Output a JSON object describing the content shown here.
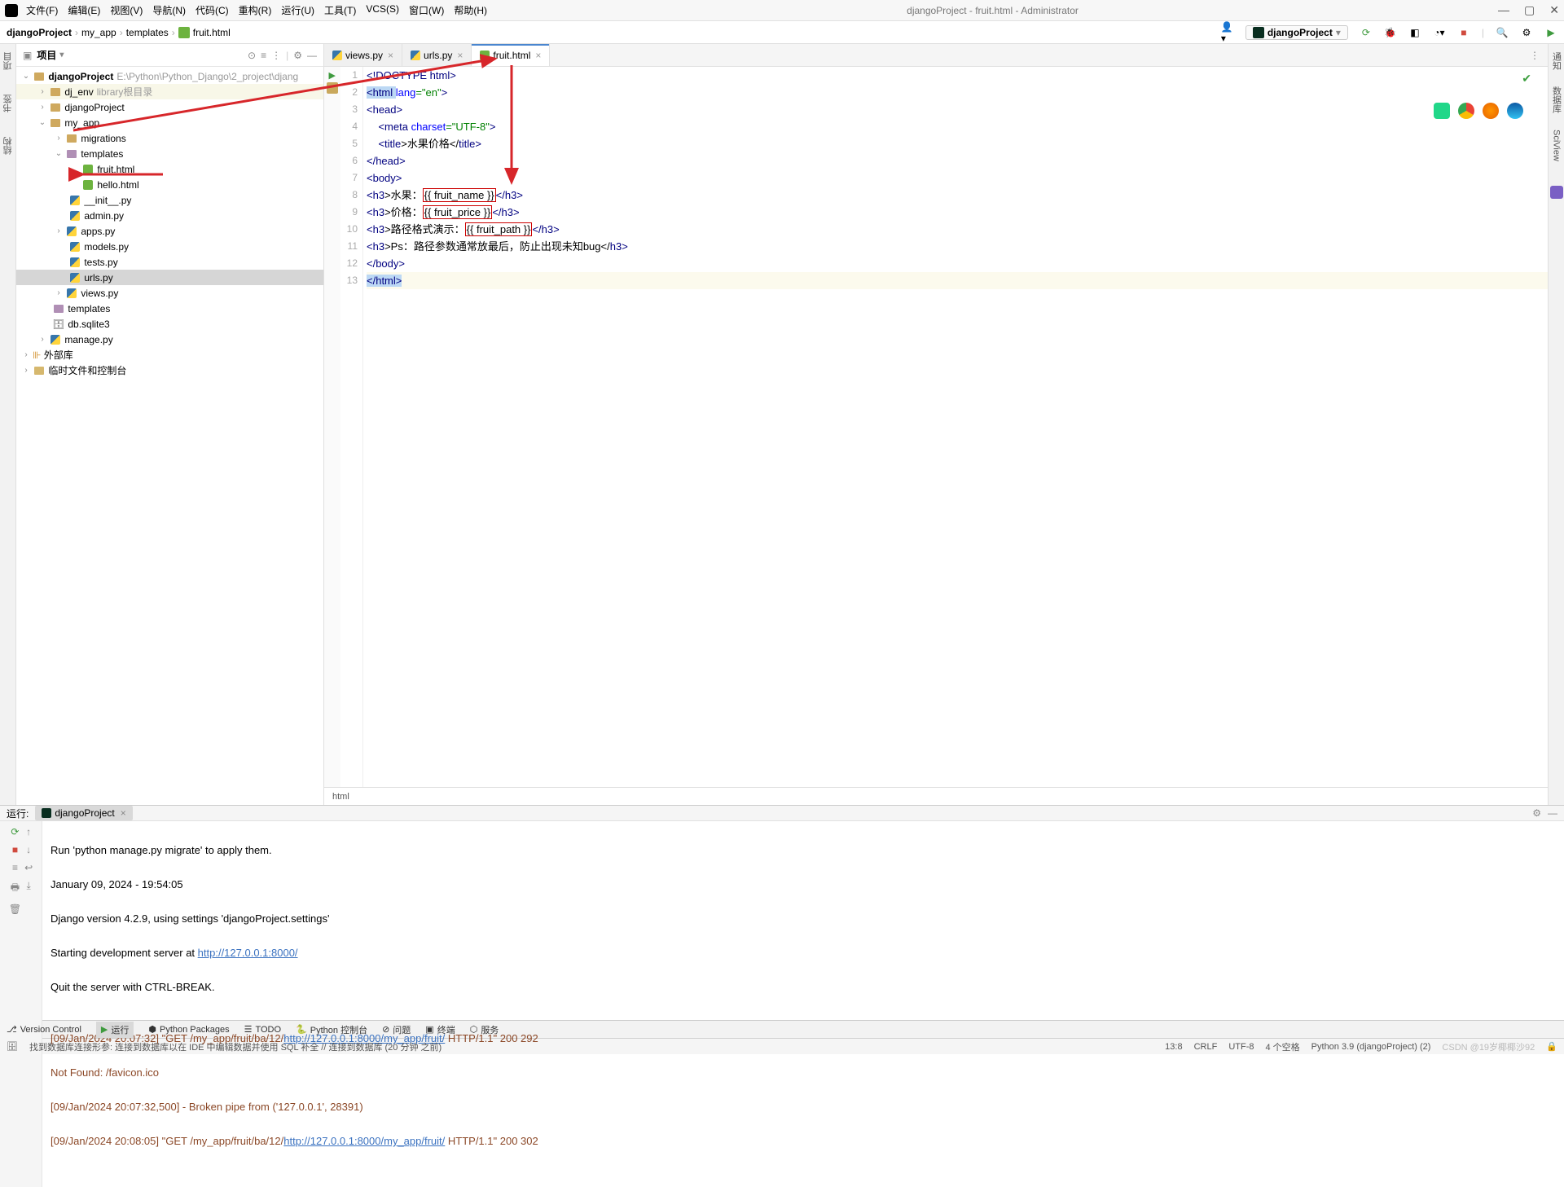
{
  "window": {
    "title": "djangoProject - fruit.html - Administrator"
  },
  "menu": {
    "file": "文件(F)",
    "edit": "编辑(E)",
    "view": "视图(V)",
    "navigate": "导航(N)",
    "code": "代码(C)",
    "refactor": "重构(R)",
    "run": "运行(U)",
    "tools": "工具(T)",
    "vcs": "VCS(S)",
    "window": "窗口(W)",
    "help": "帮助(H)"
  },
  "breadcrumbs": [
    "djangoProject",
    "my_app",
    "templates",
    "fruit.html"
  ],
  "run_config_name": "djangoProject",
  "project_panel": {
    "title": "项目"
  },
  "tree": {
    "root": "djangoProject",
    "root_path": "E:\\Python\\Python_Django\\2_project\\djang",
    "dj_env": "dj_env",
    "dj_env_hint": "library根目录",
    "django_project": "djangoProject",
    "my_app": "my_app",
    "migrations": "migrations",
    "templates": "templates",
    "fruit_html": "fruit.html",
    "hello_html": "hello.html",
    "init_py": "__init__.py",
    "admin_py": "admin.py",
    "apps_py": "apps.py",
    "models_py": "models.py",
    "tests_py": "tests.py",
    "urls_py": "urls.py",
    "views_py": "views.py",
    "templates2": "templates",
    "db_sqlite3": "db.sqlite3",
    "manage_py": "manage.py",
    "external_libs": "外部库",
    "scratches": "临时文件和控制台"
  },
  "tabs": {
    "views": "views.py",
    "urls": "urls.py",
    "fruit": "fruit.html"
  },
  "gutter": [
    "1",
    "2",
    "3",
    "4",
    "5",
    "6",
    "7",
    "8",
    "9",
    "10",
    "11",
    "12",
    "13"
  ],
  "code": {
    "l1_a": "<!DOCTYPE ",
    "l1_b": "html",
    "l1_c": ">",
    "l2_a": "<",
    "l2_b": "html ",
    "l2_c": "lang",
    "l2_d": "=\"en\"",
    "l2_e": ">",
    "l3": "<head>",
    "l4_a": "    <",
    "l4_b": "meta ",
    "l4_c": "charset",
    "l4_d": "=\"UTF-8\"",
    "l4_e": ">",
    "l5_a": "    <",
    "l5_b": "title",
    "l5_c": ">水果价格</",
    "l5_d": "title",
    "l5_e": ">",
    "l6": "</head>",
    "l7": "<body>",
    "l8_a": "<",
    "l8_b": "h3",
    "l8_c": ">水果：",
    "l8_brace": "{{ fruit_name }}",
    "l8_d": "</",
    "l8_e": "h3",
    "l8_f": ">",
    "l9_a": "<",
    "l9_b": "h3",
    "l9_c": ">价格：",
    "l9_brace": "{{ fruit_price }}",
    "l9_d": "</",
    "l9_e": "h3",
    "l9_f": ">",
    "l10_a": "<",
    "l10_b": "h3",
    "l10_c": ">路径格式演示：",
    "l10_brace": "{{ fruit_path }}",
    "l10_d": "</",
    "l10_e": "h3",
    "l10_f": ">",
    "l11_a": "<",
    "l11_b": "h3",
    "l11_c": ">Ps：路径参数通常放最后，防止出现未知bug</",
    "l11_d": "h3",
    "l11_e": ">",
    "l12": "</body>",
    "l13_a": "</",
    "l13_b": "html",
    "l13_c": ">"
  },
  "editor_breadcrumb": "html",
  "run": {
    "label": "运行:",
    "tab": "djangoProject"
  },
  "console": {
    "l1": "Run 'python manage.py migrate' to apply them.",
    "l2": "January 09, 2024 - 19:54:05",
    "l3": "Django version 4.2.9, using settings 'djangoProject.settings'",
    "l4a": "Starting development server at ",
    "l4b": "http://127.0.0.1:8000/",
    "l5": "Quit the server with CTRL-BREAK.",
    "l6": "",
    "l7a": "[09/Jan/2024 20:07:32] \"GET /my_app/fruit/ba/12/",
    "l7b": "http://127.0.0.1:8000/my_app/fruit/",
    "l7c": " HTTP/1.1\" 200 292",
    "l8": "Not Found: /favicon.ico",
    "l9": "[09/Jan/2024 20:07:32,500] - Broken pipe from ('127.0.0.1', 28391)",
    "l10a": "[09/Jan/2024 20:08:05] \"GET /my_app/fruit/ba/12/",
    "l10b": "http://127.0.0.1:8000/my_app/fruit/",
    "l10c": " HTTP/1.1\" 200 302"
  },
  "bottom": {
    "version_control": "Version Control",
    "run": "运行",
    "python_packages": "Python Packages",
    "todo": "TODO",
    "python_console": "Python 控制台",
    "problems": "问题",
    "terminal": "终端",
    "services": "服务"
  },
  "status": {
    "msg": "找到数据库连接形参: 连接到数据库以在 IDE 中编辑数据并使用 SQL 补全 // 连接到数据库 (20 分钟 之前)",
    "pos": "13:8",
    "crlf": "CRLF",
    "encoding": "UTF-8",
    "indent": "4 个空格",
    "python": "Python 3.9 (djangoProject) (2)",
    "watermark": "CSDN @19岁椰椰沙92"
  },
  "sidebars": {
    "left1": "项目",
    "left2": "书签",
    "left3": "结构",
    "right1": "通知",
    "right2": "数据库",
    "right3": "SciView"
  }
}
